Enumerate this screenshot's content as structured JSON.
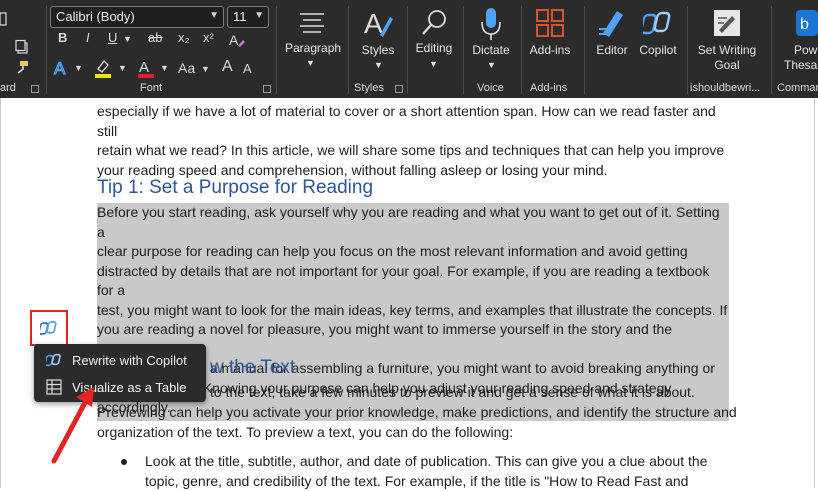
{
  "ribbon": {
    "clipboard_label": "ard",
    "font_group_label": "Font",
    "font_name": "Calibri (Body)",
    "font_size": "11",
    "paragraph_label": "Paragraph",
    "styles_label": "Styles",
    "styles_group_label": "Styles",
    "editing_label": "Editing",
    "dictate_label": "Dictate",
    "voice_group_label": "Voice",
    "addins_label": "Add-ins",
    "addins_group_label": "Add-ins",
    "editor_label": "Editor",
    "copilot_label": "Copilot",
    "set_goal_line1": "Set Writing",
    "set_goal_line2": "Goal",
    "ishouldbe_group_label": "ishouldbewri...",
    "thesaurus_line1": "Pow",
    "thesaurus_line2": "Thesau",
    "commands_group_label": "Comman",
    "bold": "B",
    "italic": "I",
    "underline": "U",
    "strike": "ab",
    "subscript": "x₂",
    "superscript": "x²",
    "font_color_letter": "A",
    "case": "Aa",
    "grow": "A",
    "shrink": "A",
    "colors": {
      "highlight": "#f5e600",
      "font": "#e02424",
      "accent_blue": "#4fa3f7",
      "addins": "#d9532c"
    }
  },
  "document": {
    "intro_lines": [
      "especially if we have a lot of material to cover or a short attention span. How can we read faster and still",
      "retain what we read? In this article, we will share some tips and techniques that can help you improve",
      "your reading speed and comprehension, without falling asleep or losing your mind."
    ],
    "heading1": "Tip 1: Set a Purpose for Reading",
    "selected_lines": [
      "Before you start reading, ask yourself why you are reading and what you want to get out of it. Setting a",
      "clear purpose for reading can help you focus on the most relevant information and avoid getting",
      "distracted by details that are not important for your goal. For example, if you are reading a textbook for a",
      "test, you might want to look for the main ideas, key terms, and examples that illustrate the concepts. If",
      "you are reading a novel for pleasure, you might want to immerse yourself in the story and the characters.",
      "If you are reading a manual for assembling a furniture, you might want to avoid breaking anything or",
      "injuring yourself. Knowing your purpose can help you adjust your reading speed and strategy accordingly."
    ],
    "heading2_visible": "w the Text",
    "preview_lines_partial": "to the text, take a few minutes to preview it and get a sense of what it is about.",
    "preview_lines": [
      "Previewing can help you activate your prior knowledge, make predictions, and identify the structure and",
      "organization of the text. To preview a text, you can do the following:"
    ],
    "bullet_lines": [
      "Look at the title, subtitle, author, and date of publication. This can give you a clue about the",
      "topic, genre, and credibility of the text. For example, if the title is \"How to Read Fast and"
    ]
  },
  "context_menu": {
    "item1": "Rewrite with Copilot",
    "item2": "Visualize as a Table"
  }
}
